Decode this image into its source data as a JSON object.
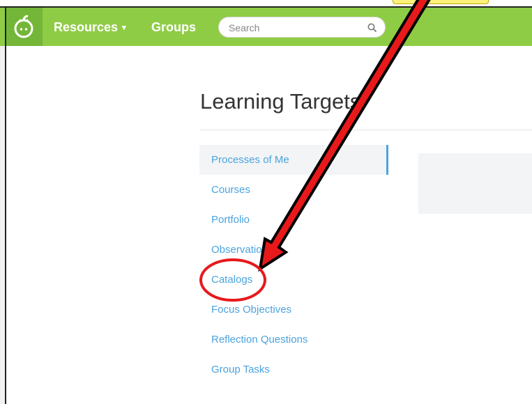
{
  "navbar": {
    "resources_label": "Resources",
    "resources_caret": "▾",
    "groups_label": "Groups"
  },
  "search": {
    "placeholder": "Search"
  },
  "page": {
    "title": "Learning Targets"
  },
  "menu": {
    "items": [
      {
        "label": "Processes of Me",
        "active": true
      },
      {
        "label": "Courses"
      },
      {
        "label": "Portfolio"
      },
      {
        "label": "Observations"
      },
      {
        "label": "Catalogs"
      },
      {
        "label": "Focus Objectives"
      },
      {
        "label": "Reflection Questions"
      },
      {
        "label": "Group Tasks"
      }
    ]
  },
  "colors": {
    "navbar": "#8fcc45",
    "logo_box": "#74b638",
    "link": "#4aa3df",
    "annotation_red": "#e8191b"
  },
  "icons": {
    "logo": "apple-logo-icon",
    "search": "search-icon",
    "caret": "chevron-down-icon"
  }
}
